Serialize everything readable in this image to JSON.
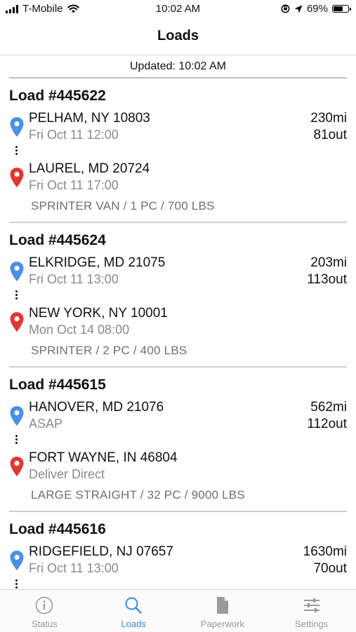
{
  "status_bar": {
    "carrier": "T-Mobile",
    "time": "10:02 AM",
    "battery_text": "69%",
    "battery_level": 0.69
  },
  "nav": {
    "title": "Loads"
  },
  "updated": "Updated: 10:02 AM",
  "loads": [
    {
      "title": "Load #445622",
      "origin": {
        "city": "PELHAM, NY 10803",
        "time": "Fri Oct 11 12:00"
      },
      "miles": "230mi",
      "out": "81out",
      "destination": {
        "city": "LAUREL, MD 20724",
        "time": "Fri Oct 11 17:00"
      },
      "description": "SPRINTER VAN / 1 PC / 700 LBS"
    },
    {
      "title": "Load #445624",
      "origin": {
        "city": "ELKRIDGE, MD 21075",
        "time": "Fri Oct 11 13:00"
      },
      "miles": "203mi",
      "out": "113out",
      "destination": {
        "city": "NEW YORK, NY 10001",
        "time": "Mon Oct 14 08:00"
      },
      "description": "SPRINTER / 2 PC / 400 LBS"
    },
    {
      "title": "Load #445615",
      "origin": {
        "city": "HANOVER, MD 21076",
        "time": "ASAP"
      },
      "miles": "562mi",
      "out": "112out",
      "destination": {
        "city": "FORT WAYNE, IN 46804",
        "time": "Deliver Direct"
      },
      "description": "LARGE STRAIGHT / 32 PC / 9000 LBS"
    },
    {
      "title": "Load #445616",
      "origin": {
        "city": "RIDGEFIELD, NJ 07657",
        "time": "Fri Oct 11 13:00"
      },
      "miles": "1630mi",
      "out": "70out"
    }
  ],
  "tabs": [
    {
      "label": "Status",
      "icon": "info-icon"
    },
    {
      "label": "Loads",
      "icon": "search-icon"
    },
    {
      "label": "Paperwork",
      "icon": "document-icon"
    },
    {
      "label": "Settings",
      "icon": "sliders-icon"
    }
  ],
  "colors": {
    "origin_pin": "#4a8fe7",
    "destination_pin": "#e0382e",
    "active_tab": "#3a8be8",
    "inactive_tab": "#9a9a9a"
  }
}
